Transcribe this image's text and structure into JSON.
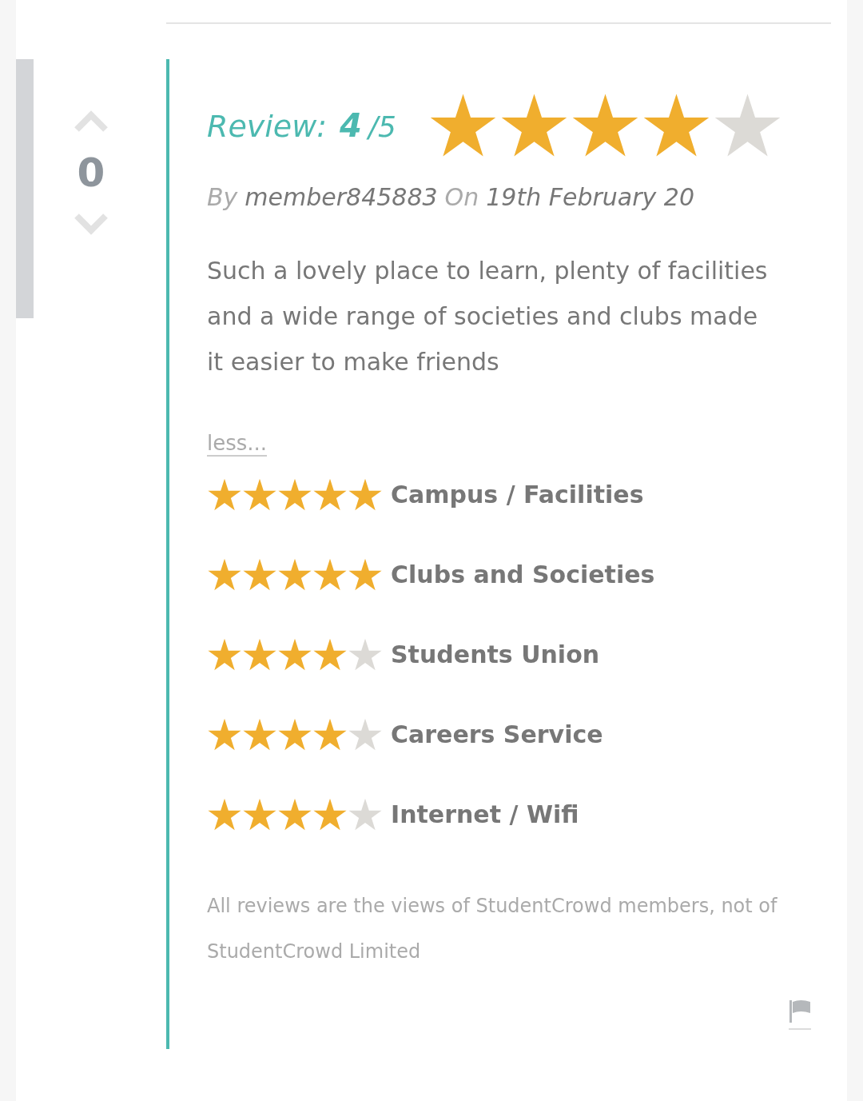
{
  "vote": {
    "count": "0"
  },
  "review": {
    "label": "Review:",
    "score": "4",
    "out_of": "/5",
    "stars": 4
  },
  "byline": {
    "by": "By",
    "author": "member845883",
    "on": "On",
    "date": "19th February 20"
  },
  "body": "Such a lovely place to learn, plenty of facilities and a wide range of societies and clubs made it easier to make friends",
  "less_link": "less...",
  "categories": [
    {
      "name": "Campus / Facilities",
      "stars": 5
    },
    {
      "name": "Clubs and Societies",
      "stars": 5
    },
    {
      "name": "Students Union",
      "stars": 4
    },
    {
      "name": "Careers Service",
      "stars": 4
    },
    {
      "name": "Internet / Wifi",
      "stars": 4
    }
  ],
  "disclaimer": "All reviews are the views of StudentCrowd members, not of StudentCrowd Limited"
}
